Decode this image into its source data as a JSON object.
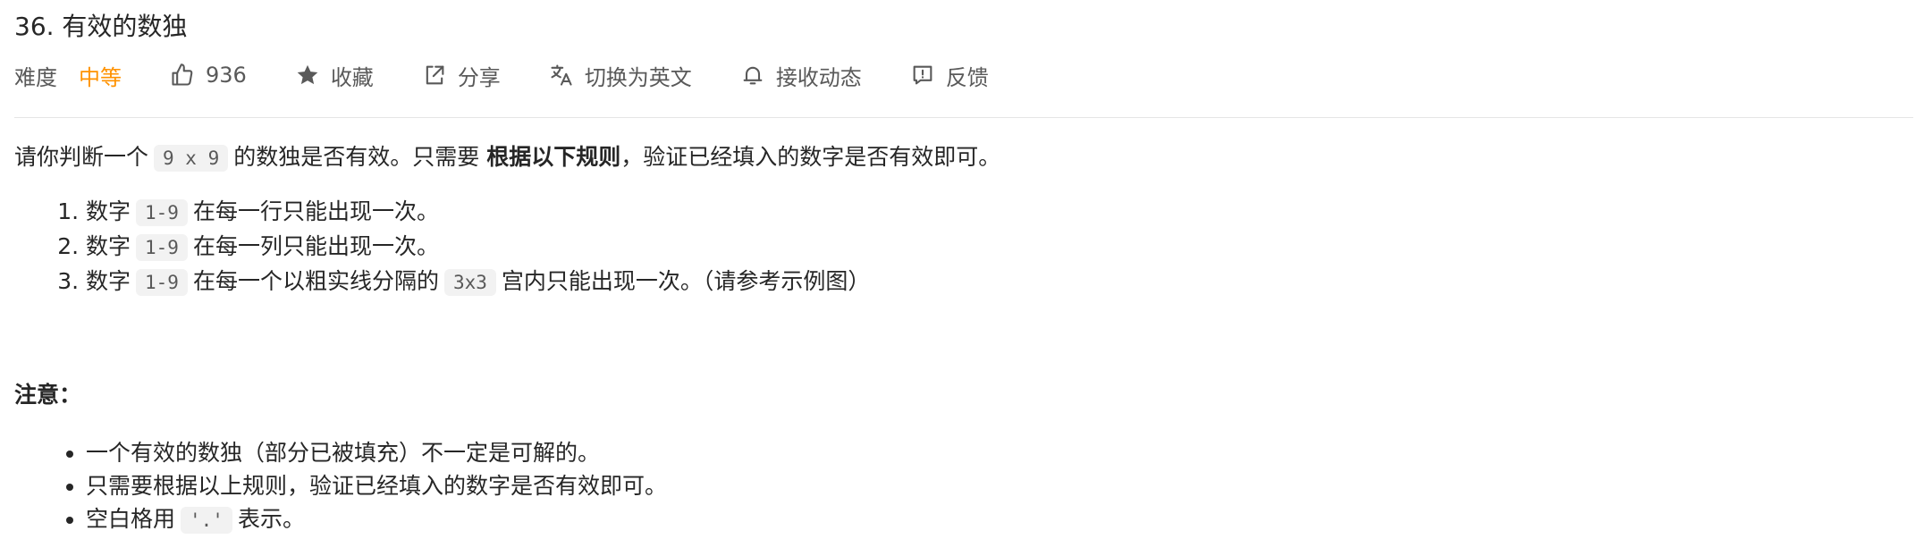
{
  "problem": {
    "title": "36. 有效的数独"
  },
  "meta": {
    "difficulty_label": "难度",
    "difficulty_value": "中等",
    "likes": "936",
    "favorite": "收藏",
    "share": "分享",
    "switch_lang": "切换为英文",
    "subscribe": "接收动态",
    "feedback": "反馈"
  },
  "colors": {
    "difficulty_medium": "#ff9200",
    "text": "#262626",
    "secondary_text": "#595959",
    "code_bg": "#f2f2f2",
    "divider": "#e5e5e5"
  },
  "icons": {
    "likes": "thumbs-up-icon",
    "favorite": "star-icon",
    "share": "share-icon",
    "switch_lang": "translate-icon",
    "subscribe": "bell-icon",
    "feedback": "feedback-icon"
  },
  "description": {
    "intro_pre": "请你判断一个",
    "intro_code": "9 x 9",
    "intro_mid": "的数独是否有效。只需要",
    "intro_bold": "根据以下规则",
    "intro_post": "，验证已经填入的数字是否有效即可。",
    "rules": [
      {
        "pre": "数字",
        "code": "1-9",
        "post": "在每一行只能出现一次。"
      },
      {
        "pre": "数字",
        "code": "1-9",
        "post": "在每一列只能出现一次。"
      },
      {
        "pre": "数字",
        "code": "1-9",
        "post_a": "在每一个以粗实线分隔的",
        "code2": "3x3",
        "post_b": "宫内只能出现一次。（请参考示例图）"
      }
    ]
  },
  "notes": {
    "title": "注意：",
    "items": [
      "一个有效的数独（部分已被填充）不一定是可解的。",
      "只需要根据以上规则，验证已经填入的数字是否有效即可。"
    ],
    "last_pre": "空白格用",
    "last_code": "'.'",
    "last_post": "表示。"
  }
}
